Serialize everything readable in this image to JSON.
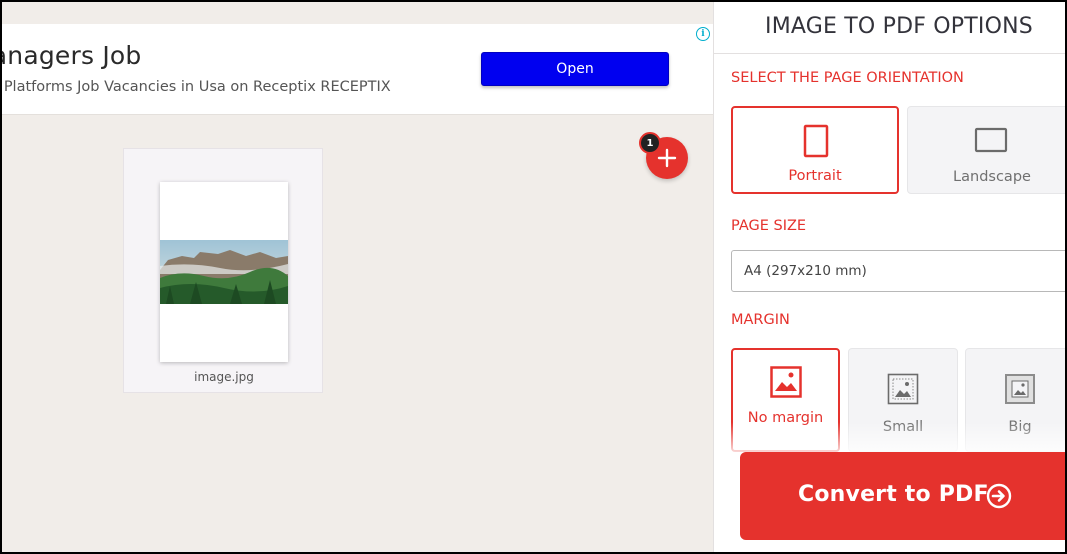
{
  "ad": {
    "title": "Managers Job",
    "subtitle": "g Platforms Job Vacancies in Usa on Receptix RECEPTIX",
    "open_label": "Open",
    "info_icon": "info-icon"
  },
  "workspace": {
    "file_name": "image.jpg",
    "file_count": "1",
    "add_icon": "plus-icon"
  },
  "sidebar": {
    "title": "IMAGE TO PDF OPTIONS",
    "orientation": {
      "label": "SELECT THE PAGE ORIENTATION",
      "options": [
        {
          "label": "Portrait",
          "icon": "portrait-page-icon",
          "selected": true
        },
        {
          "label": "Landscape",
          "icon": "landscape-page-icon",
          "selected": false
        }
      ]
    },
    "page_size": {
      "label": "PAGE SIZE",
      "value": "A4 (297x210 mm)"
    },
    "margin": {
      "label": "MARGIN",
      "options": [
        {
          "label": "No margin",
          "icon": "no-margin-image-icon",
          "selected": true
        },
        {
          "label": "Small",
          "icon": "small-margin-image-icon",
          "selected": false
        },
        {
          "label": "Big",
          "icon": "big-margin-image-icon",
          "selected": false
        }
      ]
    },
    "convert_label": "Convert to PDF",
    "convert_icon": "circle-arrow-right-icon"
  },
  "colors": {
    "accent": "#e5322d",
    "ad_button": "#0000f0",
    "background": "#f1ede9"
  }
}
